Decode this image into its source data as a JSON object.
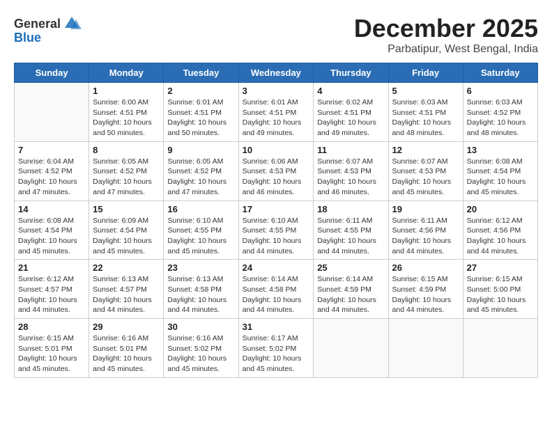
{
  "header": {
    "logo_general": "General",
    "logo_blue": "Blue",
    "month_title": "December 2025",
    "location": "Parbatipur, West Bengal, India"
  },
  "days_of_week": [
    "Sunday",
    "Monday",
    "Tuesday",
    "Wednesday",
    "Thursday",
    "Friday",
    "Saturday"
  ],
  "weeks": [
    [
      {
        "day": "",
        "sunrise": "",
        "sunset": "",
        "daylight": ""
      },
      {
        "day": "1",
        "sunrise": "Sunrise: 6:00 AM",
        "sunset": "Sunset: 4:51 PM",
        "daylight": "Daylight: 10 hours and 50 minutes."
      },
      {
        "day": "2",
        "sunrise": "Sunrise: 6:01 AM",
        "sunset": "Sunset: 4:51 PM",
        "daylight": "Daylight: 10 hours and 50 minutes."
      },
      {
        "day": "3",
        "sunrise": "Sunrise: 6:01 AM",
        "sunset": "Sunset: 4:51 PM",
        "daylight": "Daylight: 10 hours and 49 minutes."
      },
      {
        "day": "4",
        "sunrise": "Sunrise: 6:02 AM",
        "sunset": "Sunset: 4:51 PM",
        "daylight": "Daylight: 10 hours and 49 minutes."
      },
      {
        "day": "5",
        "sunrise": "Sunrise: 6:03 AM",
        "sunset": "Sunset: 4:51 PM",
        "daylight": "Daylight: 10 hours and 48 minutes."
      },
      {
        "day": "6",
        "sunrise": "Sunrise: 6:03 AM",
        "sunset": "Sunset: 4:52 PM",
        "daylight": "Daylight: 10 hours and 48 minutes."
      }
    ],
    [
      {
        "day": "7",
        "sunrise": "Sunrise: 6:04 AM",
        "sunset": "Sunset: 4:52 PM",
        "daylight": "Daylight: 10 hours and 47 minutes."
      },
      {
        "day": "8",
        "sunrise": "Sunrise: 6:05 AM",
        "sunset": "Sunset: 4:52 PM",
        "daylight": "Daylight: 10 hours and 47 minutes."
      },
      {
        "day": "9",
        "sunrise": "Sunrise: 6:05 AM",
        "sunset": "Sunset: 4:52 PM",
        "daylight": "Daylight: 10 hours and 47 minutes."
      },
      {
        "day": "10",
        "sunrise": "Sunrise: 6:06 AM",
        "sunset": "Sunset: 4:53 PM",
        "daylight": "Daylight: 10 hours and 46 minutes."
      },
      {
        "day": "11",
        "sunrise": "Sunrise: 6:07 AM",
        "sunset": "Sunset: 4:53 PM",
        "daylight": "Daylight: 10 hours and 46 minutes."
      },
      {
        "day": "12",
        "sunrise": "Sunrise: 6:07 AM",
        "sunset": "Sunset: 4:53 PM",
        "daylight": "Daylight: 10 hours and 45 minutes."
      },
      {
        "day": "13",
        "sunrise": "Sunrise: 6:08 AM",
        "sunset": "Sunset: 4:54 PM",
        "daylight": "Daylight: 10 hours and 45 minutes."
      }
    ],
    [
      {
        "day": "14",
        "sunrise": "Sunrise: 6:08 AM",
        "sunset": "Sunset: 4:54 PM",
        "daylight": "Daylight: 10 hours and 45 minutes."
      },
      {
        "day": "15",
        "sunrise": "Sunrise: 6:09 AM",
        "sunset": "Sunset: 4:54 PM",
        "daylight": "Daylight: 10 hours and 45 minutes."
      },
      {
        "day": "16",
        "sunrise": "Sunrise: 6:10 AM",
        "sunset": "Sunset: 4:55 PM",
        "daylight": "Daylight: 10 hours and 45 minutes."
      },
      {
        "day": "17",
        "sunrise": "Sunrise: 6:10 AM",
        "sunset": "Sunset: 4:55 PM",
        "daylight": "Daylight: 10 hours and 44 minutes."
      },
      {
        "day": "18",
        "sunrise": "Sunrise: 6:11 AM",
        "sunset": "Sunset: 4:55 PM",
        "daylight": "Daylight: 10 hours and 44 minutes."
      },
      {
        "day": "19",
        "sunrise": "Sunrise: 6:11 AM",
        "sunset": "Sunset: 4:56 PM",
        "daylight": "Daylight: 10 hours and 44 minutes."
      },
      {
        "day": "20",
        "sunrise": "Sunrise: 6:12 AM",
        "sunset": "Sunset: 4:56 PM",
        "daylight": "Daylight: 10 hours and 44 minutes."
      }
    ],
    [
      {
        "day": "21",
        "sunrise": "Sunrise: 6:12 AM",
        "sunset": "Sunset: 4:57 PM",
        "daylight": "Daylight: 10 hours and 44 minutes."
      },
      {
        "day": "22",
        "sunrise": "Sunrise: 6:13 AM",
        "sunset": "Sunset: 4:57 PM",
        "daylight": "Daylight: 10 hours and 44 minutes."
      },
      {
        "day": "23",
        "sunrise": "Sunrise: 6:13 AM",
        "sunset": "Sunset: 4:58 PM",
        "daylight": "Daylight: 10 hours and 44 minutes."
      },
      {
        "day": "24",
        "sunrise": "Sunrise: 6:14 AM",
        "sunset": "Sunset: 4:58 PM",
        "daylight": "Daylight: 10 hours and 44 minutes."
      },
      {
        "day": "25",
        "sunrise": "Sunrise: 6:14 AM",
        "sunset": "Sunset: 4:59 PM",
        "daylight": "Daylight: 10 hours and 44 minutes."
      },
      {
        "day": "26",
        "sunrise": "Sunrise: 6:15 AM",
        "sunset": "Sunset: 4:59 PM",
        "daylight": "Daylight: 10 hours and 44 minutes."
      },
      {
        "day": "27",
        "sunrise": "Sunrise: 6:15 AM",
        "sunset": "Sunset: 5:00 PM",
        "daylight": "Daylight: 10 hours and 45 minutes."
      }
    ],
    [
      {
        "day": "28",
        "sunrise": "Sunrise: 6:15 AM",
        "sunset": "Sunset: 5:01 PM",
        "daylight": "Daylight: 10 hours and 45 minutes."
      },
      {
        "day": "29",
        "sunrise": "Sunrise: 6:16 AM",
        "sunset": "Sunset: 5:01 PM",
        "daylight": "Daylight: 10 hours and 45 minutes."
      },
      {
        "day": "30",
        "sunrise": "Sunrise: 6:16 AM",
        "sunset": "Sunset: 5:02 PM",
        "daylight": "Daylight: 10 hours and 45 minutes."
      },
      {
        "day": "31",
        "sunrise": "Sunrise: 6:17 AM",
        "sunset": "Sunset: 5:02 PM",
        "daylight": "Daylight: 10 hours and 45 minutes."
      },
      {
        "day": "",
        "sunrise": "",
        "sunset": "",
        "daylight": ""
      },
      {
        "day": "",
        "sunrise": "",
        "sunset": "",
        "daylight": ""
      },
      {
        "day": "",
        "sunrise": "",
        "sunset": "",
        "daylight": ""
      }
    ]
  ]
}
